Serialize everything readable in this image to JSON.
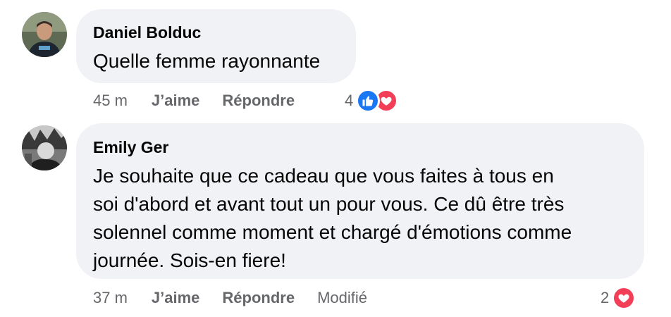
{
  "comments": [
    {
      "author": "Daniel Bolduc",
      "text_lines": [
        "Quelle femme rayonnante"
      ],
      "time": "45 m",
      "like_label": "J’aime",
      "reply_label": "Répondre",
      "edited_label": "",
      "reaction_count": "4",
      "reactions": [
        "like-icon",
        "love-icon"
      ]
    },
    {
      "author": "Emily Ger",
      "text_lines": [
        "Je souhaite que ce cadeau que vous faites à tous en",
        "soi d'abord et avant tout un pour vous. Ce dû être très",
        "solennel comme moment et chargé d'émotions comme",
        "journée. Sois-en fiere!"
      ],
      "time": "37 m",
      "like_label": "J’aime",
      "reply_label": "Répondre",
      "edited_label": "Modifié",
      "reaction_count": "2",
      "reactions": [
        "love-icon"
      ]
    }
  ],
  "colors": {
    "bubble": "#f0f2f5",
    "meta_text": "#65676b",
    "like": "#1877f2",
    "love": "#f33e58"
  }
}
